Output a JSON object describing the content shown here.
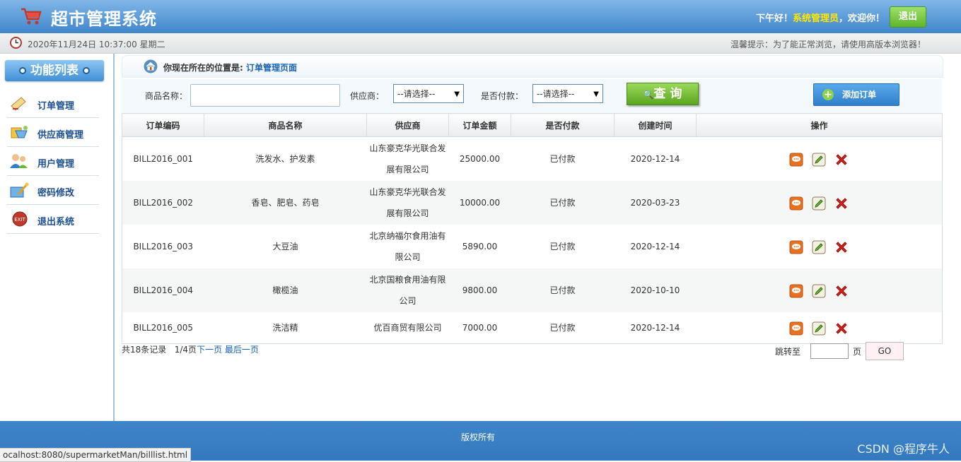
{
  "header": {
    "title": "超市管理系统",
    "greeting_prefix": "下午好！",
    "role": "系统管理员",
    "greeting_suffix": "，欢迎你！",
    "logout_label": "退出"
  },
  "infobar": {
    "datetime": "2020年11月24日 10:37:00 星期二",
    "tip": "温馨提示：为了能正常浏览，请使用高版本浏览器！"
  },
  "sidebar": {
    "title": "功能列表",
    "items": [
      {
        "label": "订单管理",
        "icon": "order-icon"
      },
      {
        "label": "供应商管理",
        "icon": "supplier-icon"
      },
      {
        "label": "用户管理",
        "icon": "users-icon"
      },
      {
        "label": "密码修改",
        "icon": "password-icon"
      },
      {
        "label": "退出系统",
        "icon": "exit-icon"
      }
    ]
  },
  "location": {
    "prefix": "你现在所在的位置是:",
    "page": "订单管理页面"
  },
  "search": {
    "product_label": "商品名称：",
    "product_value": "",
    "supplier_label": "供应商：",
    "supplier_selected": "--请选择--",
    "paid_label": "是否付款：",
    "paid_selected": "--请选择--",
    "query_label": "查 询",
    "add_label": "添加订单"
  },
  "table": {
    "headers": [
      "订单编码",
      "商品名称",
      "供应商",
      "订单金额",
      "是否付款",
      "创建时间",
      "操作"
    ],
    "rows": [
      {
        "code": "BILL2016_001",
        "product": "洗发水、护发素",
        "supplier": "山东豪克华光联合发展有限公司",
        "amount": "25000.00",
        "paid": "已付款",
        "created": "2020-12-14"
      },
      {
        "code": "BILL2016_002",
        "product": "香皂、肥皂、药皂",
        "supplier": "山东豪克华光联合发展有限公司",
        "amount": "10000.00",
        "paid": "已付款",
        "created": "2020-03-23"
      },
      {
        "code": "BILL2016_003",
        "product": "大豆油",
        "supplier": "北京纳福尔食用油有限公司",
        "amount": "5890.00",
        "paid": "已付款",
        "created": "2020-12-14"
      },
      {
        "code": "BILL2016_004",
        "product": "橄榄油",
        "supplier": "北京国粮食用油有限公司",
        "amount": "9800.00",
        "paid": "已付款",
        "created": "2020-10-10"
      },
      {
        "code": "BILL2016_005",
        "product": "洗洁精",
        "supplier": "优百商贸有限公司",
        "amount": "7000.00",
        "paid": "已付款",
        "created": "2020-12-14"
      }
    ]
  },
  "pager": {
    "total": "共18条记录",
    "current": "1/4页",
    "next": "下一页",
    "last": "最后一页",
    "jump_label": "跳转至",
    "page_label": "页",
    "go_label": "GO"
  },
  "footer": {
    "copyright": "版权所有",
    "watermark": "CSDN @程序牛人"
  },
  "status_url": "ocalhost:8080/supermarketMan/billlist.html",
  "colors": {
    "header_blue": "#4a90d6",
    "accent_green": "#6ab82d",
    "link_blue": "#1a62b5",
    "role_yellow": "#ffe600"
  }
}
